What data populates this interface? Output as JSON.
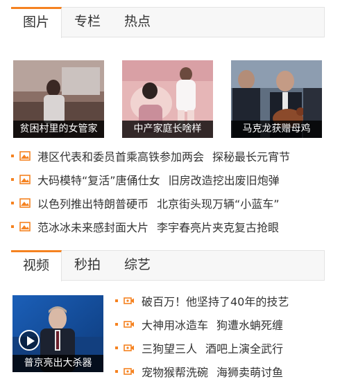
{
  "section1": {
    "tabs": [
      "图片",
      "专栏",
      "热点"
    ],
    "photos": [
      {
        "caption": "贫困村里的女管家",
        "icon": "photo-woman-in-village"
      },
      {
        "caption": "中产家庭长啥样",
        "icon": "photo-family-bed"
      },
      {
        "caption": "马克龙获赠母鸡",
        "icon": "photo-macron-hen"
      }
    ],
    "list": [
      [
        "港区代表和委员首乘高铁参加两会",
        "探秘最长元宵节"
      ],
      [
        "大码模特“复活”唐俑仕女",
        "旧房改造挖出废旧炮弹"
      ],
      [
        "以色列推出特朗普硬币",
        "北京街头现万辆“小蓝车”"
      ],
      [
        "范冰冰未来感封面大片",
        "李宇春亮片夹克复古抢眼"
      ]
    ],
    "list_icon": "image-icon"
  },
  "section2": {
    "tabs": [
      "视频",
      "秒拍",
      "综艺"
    ],
    "video": {
      "caption": "普京亮出大杀器",
      "icon": "play-icon"
    },
    "list": [
      [
        "破百万！他坚持了40年的技艺"
      ],
      [
        "大神用冰造车",
        "狗遭水蚺死缠"
      ],
      [
        "三狗望三人",
        "酒吧上演全武行"
      ],
      [
        "宠物猴帮洗碗",
        "海狮卖萌讨鱼"
      ]
    ],
    "list_icon": "video-camera-icon"
  },
  "colors": {
    "accent": "#f58220",
    "tab_bg": "#f7f7f7",
    "caption_bg": "#000000"
  }
}
